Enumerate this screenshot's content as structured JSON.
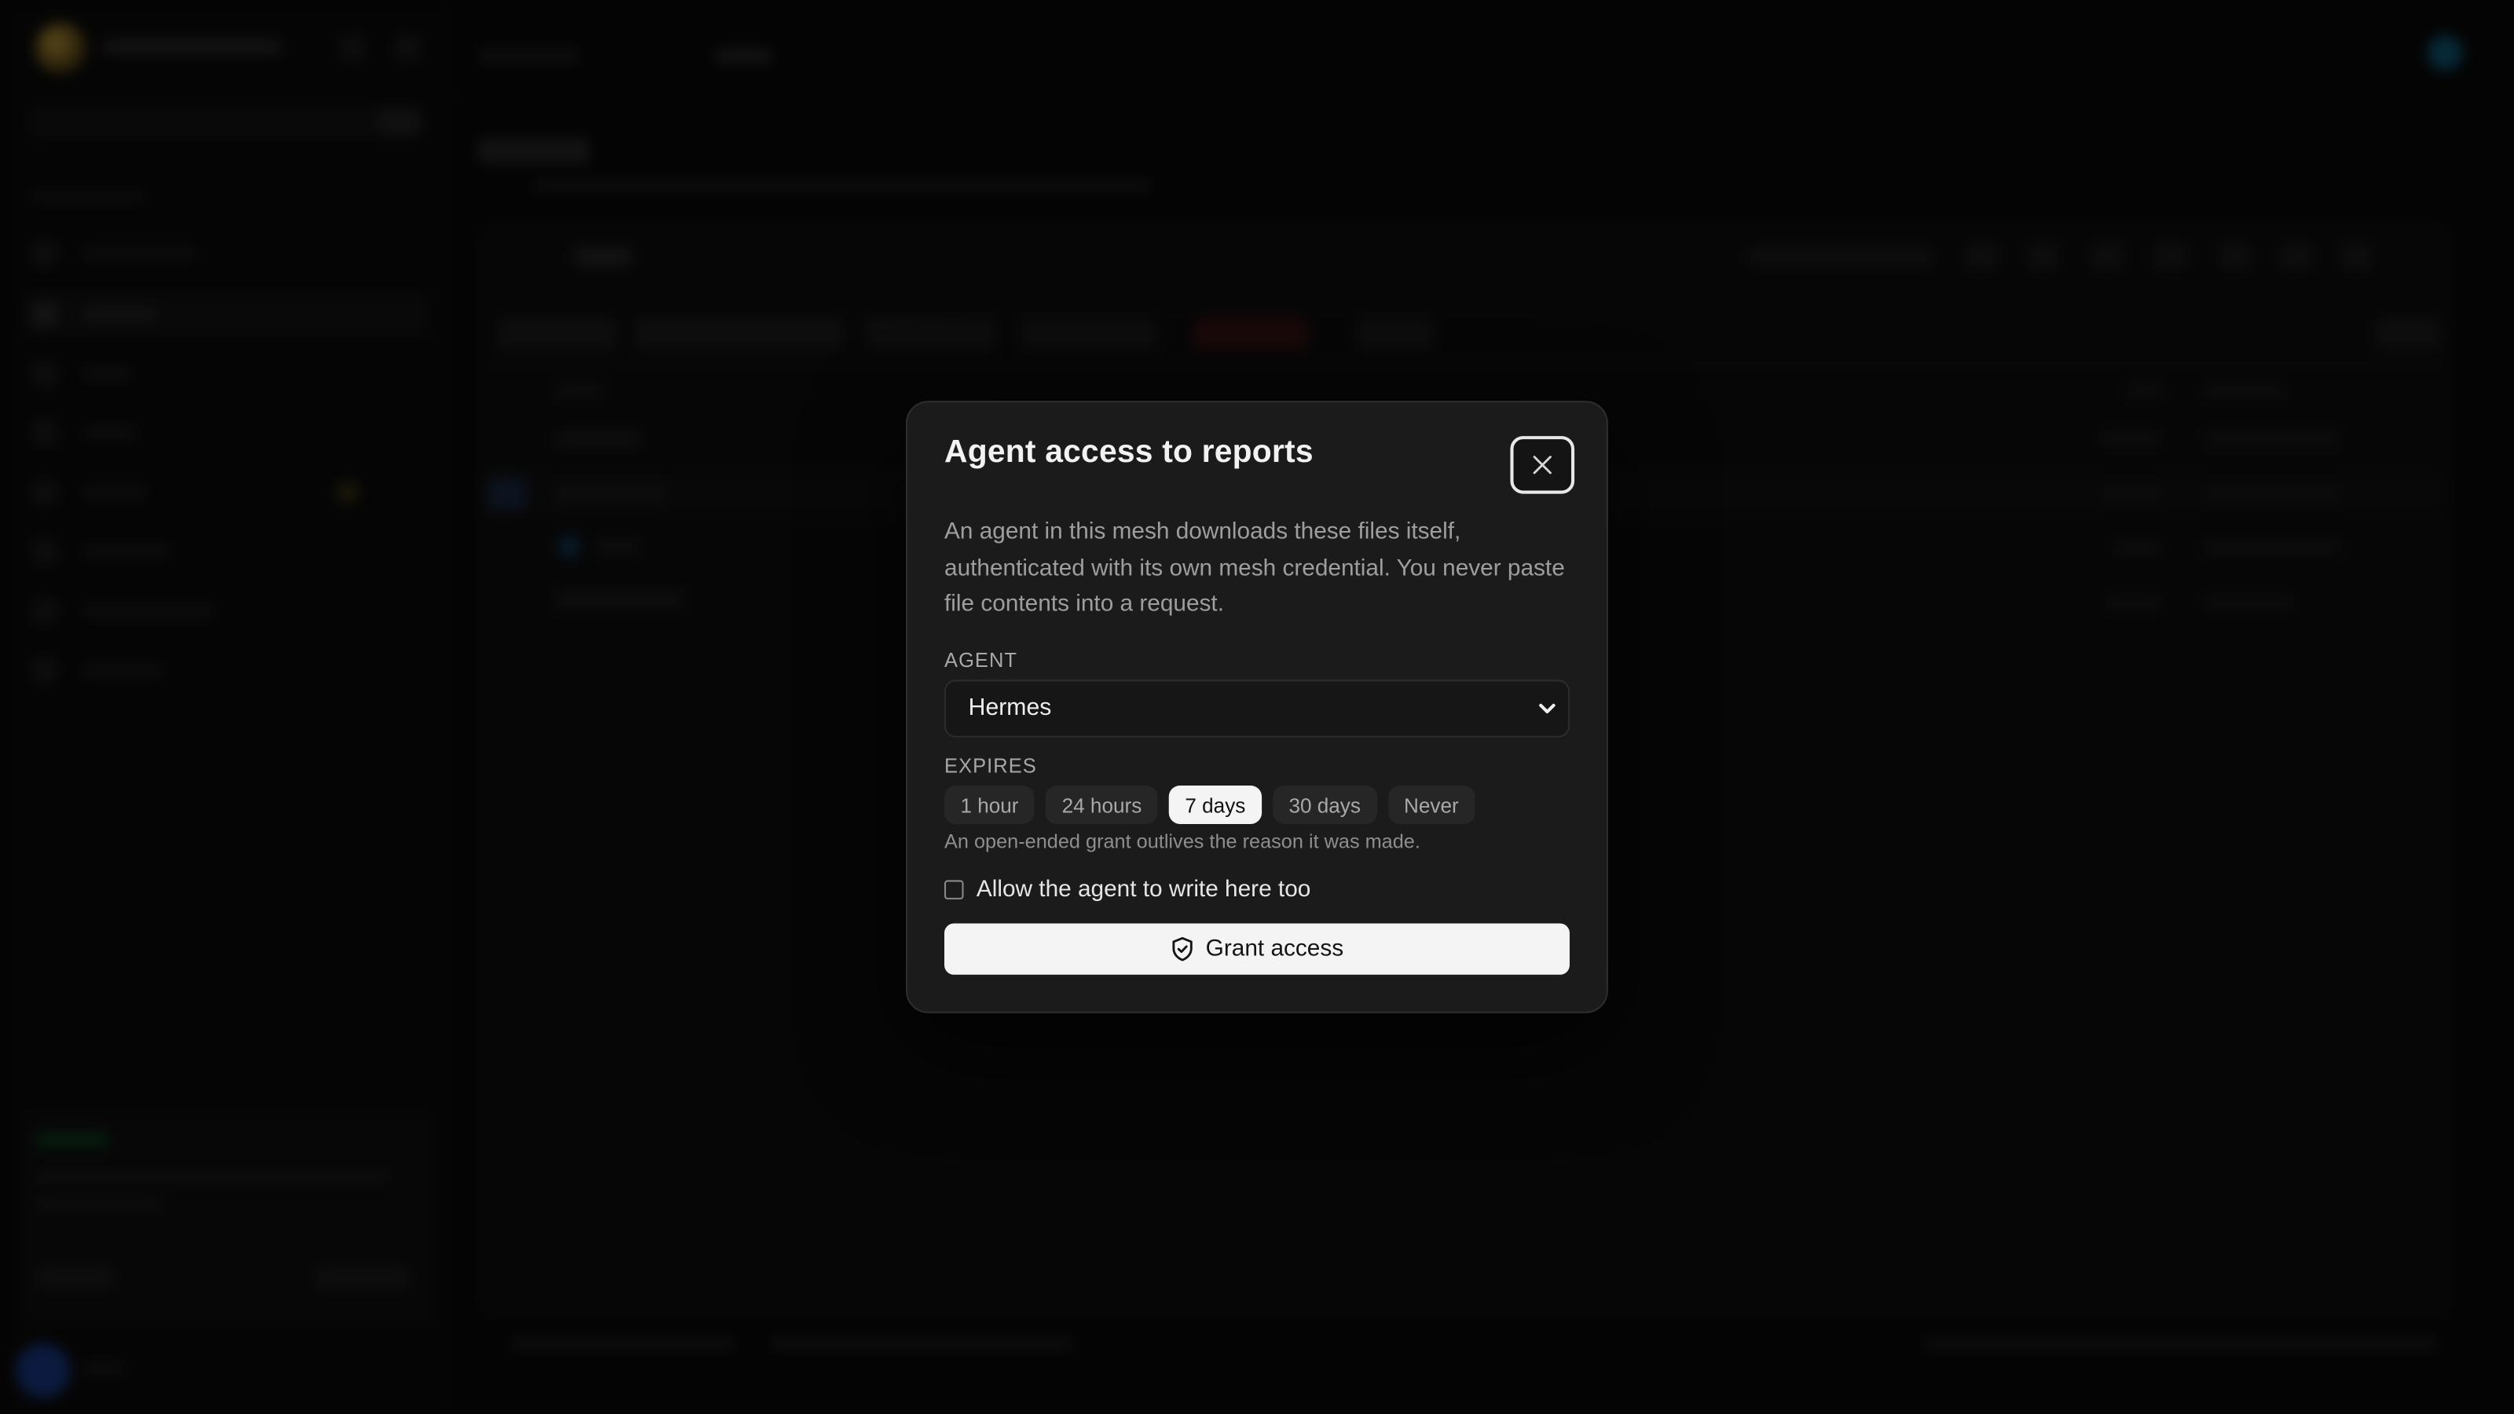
{
  "modal": {
    "title": "Agent access to reports",
    "close_icon": "close-icon",
    "description": "An agent in this mesh downloads these files itself, authenticated with its own mesh credential. You never paste file contents into a request.",
    "agent_label": "AGENT",
    "agent_selected": "Hermes",
    "expires_label": "EXPIRES",
    "expiry_options": [
      "1 hour",
      "24 hours",
      "7 days",
      "30 days",
      "Never"
    ],
    "expiry_selected": "7 days",
    "hint": "An open-ended grant outlives the reason it was made.",
    "write_checkbox_label": "Allow the agent to write here too",
    "write_checked": false,
    "grant_button_label": "Grant access",
    "grant_icon": "shield-check-icon"
  },
  "colors": {
    "background": "#0a0a0a",
    "modal_bg": "#1b1b1b",
    "accent_button": "#f4f4f4",
    "status_green": "#1f7a3a"
  }
}
